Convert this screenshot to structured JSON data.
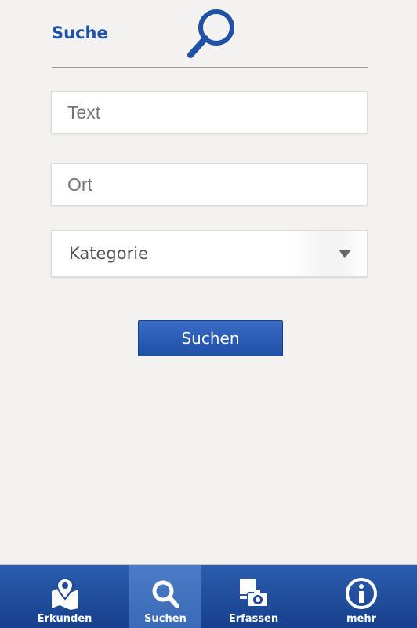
{
  "header": {
    "title": "Suche",
    "icon": "search-icon"
  },
  "form": {
    "text_placeholder": "Text",
    "ort_placeholder": "Ort",
    "category_label": "Kategorie",
    "submit_label": "Suchen"
  },
  "tabs": [
    {
      "label": "Erkunden",
      "icon": "map-pin-icon",
      "active": false
    },
    {
      "label": "Suchen",
      "icon": "search-icon",
      "active": true
    },
    {
      "label": "Erfassen",
      "icon": "camera-icon",
      "active": false
    },
    {
      "label": "mehr",
      "icon": "info-icon",
      "active": false
    }
  ],
  "colors": {
    "accent": "#1f52a6",
    "background": "#f3f2f0",
    "tabbar": "#1f4a9c"
  }
}
